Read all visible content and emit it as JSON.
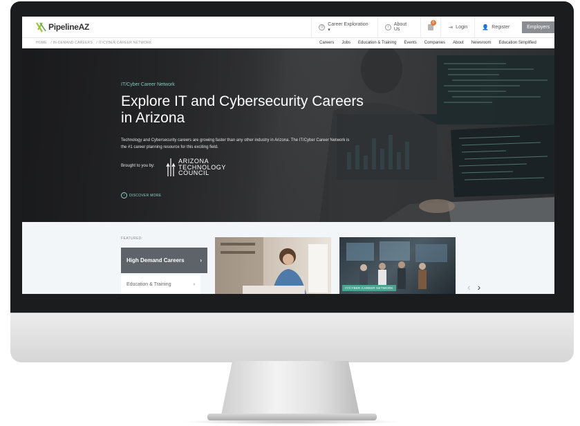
{
  "header": {
    "logo_text": "PipelineAZ",
    "nav": {
      "career_exploration": "Career Exploration ▾",
      "about_us": "About Us",
      "cart_count": "0",
      "login": "Login",
      "register": "Register",
      "employers": "Employers"
    }
  },
  "breadcrumb": [
    "HOME",
    "/ IN-DEMAND CAREERS",
    "/ IT/CYBER CAREER NETWORK"
  ],
  "subnav": [
    "Careers",
    "Jobs",
    "Education & Training",
    "Events",
    "Companies",
    "About",
    "Newsroom",
    "Education Simplified"
  ],
  "hero": {
    "kicker": "IT/Cyber Career Network",
    "title": "Explore IT and Cybersecurity Careers in Arizona",
    "description": "Technology and Cybersecurity careers are growing faster than any other industry in Arizona. The IT/Cyber Career Network is the #1 career planning resource for this exciting field.",
    "brought_by": "Brought to you by:",
    "council_lines": [
      "ARIZONA",
      "TECHNOLOGY",
      "COUNCIL"
    ],
    "discover": "DISCOVER MORE"
  },
  "featured": {
    "label": "FEATURED:",
    "categories": [
      {
        "label": "High Demand Careers",
        "chevron": "›"
      },
      {
        "label": "Education & Training",
        "chevron": "›"
      }
    ],
    "card2_tag": "IT/CYBER CAREER NETWORK",
    "prev": "‹",
    "next": "›"
  },
  "colors": {
    "accent": "#7ec9b6",
    "tag": "#4ea390",
    "employers_button": "#8a8d91",
    "active_category": "#5d6368",
    "cart_badge": "#e07b3a"
  }
}
